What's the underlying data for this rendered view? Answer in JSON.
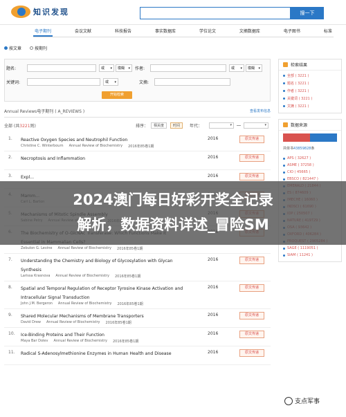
{
  "header": {
    "logo_text": "知识发现",
    "search_button": "搜一下"
  },
  "nav": [
    "电子期刊",
    "会议文献",
    "科技报告",
    "事实数据库",
    "学位论文",
    "文摘数据库",
    "电子图书",
    "标准"
  ],
  "search_mode": {
    "opt1": "按文章",
    "opt2": "按期刊"
  },
  "form": {
    "title_label": "题名:",
    "or1": "或",
    "fuzzy1": "模糊",
    "author_label": "作者:",
    "or2": "或",
    "fuzzy2": "模糊",
    "keyword_label": "关键词:",
    "or3": "或",
    "abstract_label": "文摘:",
    "submit": "开始检索"
  },
  "results": {
    "header": "Annual Reviews电子期刊 ( A_REVIEWS )",
    "view_link": "查看发布信息",
    "total_label": "全部 (共",
    "total_count": "3221",
    "total_suffix": "则)",
    "sort_label": "排序：",
    "sort_relevance": "相关度",
    "sort_time": "时间",
    "year_label": "年代：",
    "items": [
      {
        "num": "1.",
        "title": "Reactive Oxygen Species and Neutrophil Function",
        "author": "Christine C. Winterbourn",
        "journal": "Annual Review of Biochemistry",
        "issue": "2016年85卷1期",
        "year": "2016",
        "btn": "原文传递"
      },
      {
        "num": "2.",
        "title": "Necroptosis and Inflammation",
        "author": "",
        "journal": "",
        "issue": "",
        "year": "2016",
        "btn": "原文传递"
      },
      {
        "num": "3.",
        "title": "Expl...",
        "author": "",
        "journal": "",
        "issue": "",
        "year": "2016",
        "btn": "原文传递"
      },
      {
        "num": "4.",
        "title": "Mamm...",
        "author": "Carl L. Barton",
        "journal": "",
        "issue": "",
        "year": "2016",
        "btn": "原文传递"
      },
      {
        "num": "5.",
        "title": "Mechanisms of Mitotic Spindle Assembly",
        "author": "Sabine Petry",
        "journal": "Annual Review of Biochemistry",
        "issue": "2016年85卷1期",
        "year": "2016",
        "btn": "原文传递"
      },
      {
        "num": "6.",
        "title": "The Biochemistry of O-GlcNAc Transferase: Which Functions Make It Essential in Mammalian Cells?",
        "author": "Zebulon G. Levine",
        "journal": "Annual Review of Biochemistry",
        "issue": "2016年85卷1期",
        "year": "2016",
        "btn": "原文传递"
      },
      {
        "num": "7.",
        "title": "Understanding the Chemistry and Biology of Glycosylation with Glycan Synthesis",
        "author": "Larissa Krasnova",
        "journal": "Annual Review of Biochemistry",
        "issue": "2016年85卷1期",
        "year": "2016",
        "btn": "原文传递"
      },
      {
        "num": "8.",
        "title": "Spatial and Temporal Regulation of Receptor Tyrosine Kinase Activation and Intracellular Signal Transduction",
        "author": "John J.M. Bergeron",
        "journal": "Annual Review of Biochemistry",
        "issue": "2016年85卷1期",
        "year": "2016",
        "btn": "原文传递"
      },
      {
        "num": "9.",
        "title": "Shared Molecular Mechanisms of Membrane Transporters",
        "author": "David Drew",
        "journal": "Annual Review of Biochemistry",
        "issue": "2016年85卷1期",
        "year": "2016",
        "btn": "原文传递"
      },
      {
        "num": "10.",
        "title": "Ice-Binding Proteins and Their Function",
        "author": "Maya Bar Dolev",
        "journal": "Annual Review of Biochemistry",
        "issue": "2016年85卷1期",
        "year": "2016",
        "btn": "原文传递"
      },
      {
        "num": "11.",
        "title": "Radical S-Adenosylmethionine Enzymes in Human Health and Disease",
        "author": "",
        "journal": "",
        "issue": "",
        "year": "2016",
        "btn": "原文传递"
      }
    ]
  },
  "sidebar": {
    "search_results_title": "检索结果",
    "result_items": [
      "全部 ( 3221 )",
      "题名 ( 3221 )",
      "作者 ( 3221 )",
      "关键词 ( 3221 )",
      "文摘 ( 3221 )"
    ],
    "source_title": "数据来源",
    "total_text": "共依书",
    "total_count": "43859828",
    "total_suffix": "条",
    "source_items": [
      "APS ( 32627 )",
      "ASME ( 37258 )",
      "CIO ( 45665 )",
      "EBSCO ( 821447 )",
      "EMERALD ( 21844 )",
      "ES ( 874609 )",
      "IMECHE ( 16060 )",
      "INDSCI ( 61690 )",
      "IOP ( 250507 )",
      "NATURE ( 419729 )",
      "OSA ( 93642 )",
      "OXFORD ( 406284 )",
      "PROQUEST ( 2905284 )",
      "SAGE ( 1119051 )",
      "SIAM ( 11241 )"
    ]
  },
  "overlay": {
    "line1": "2024澳门每日好彩开奖全记录",
    "line2": "解析，数据资料详述_冒险SM"
  },
  "watermark": "支点军事"
}
